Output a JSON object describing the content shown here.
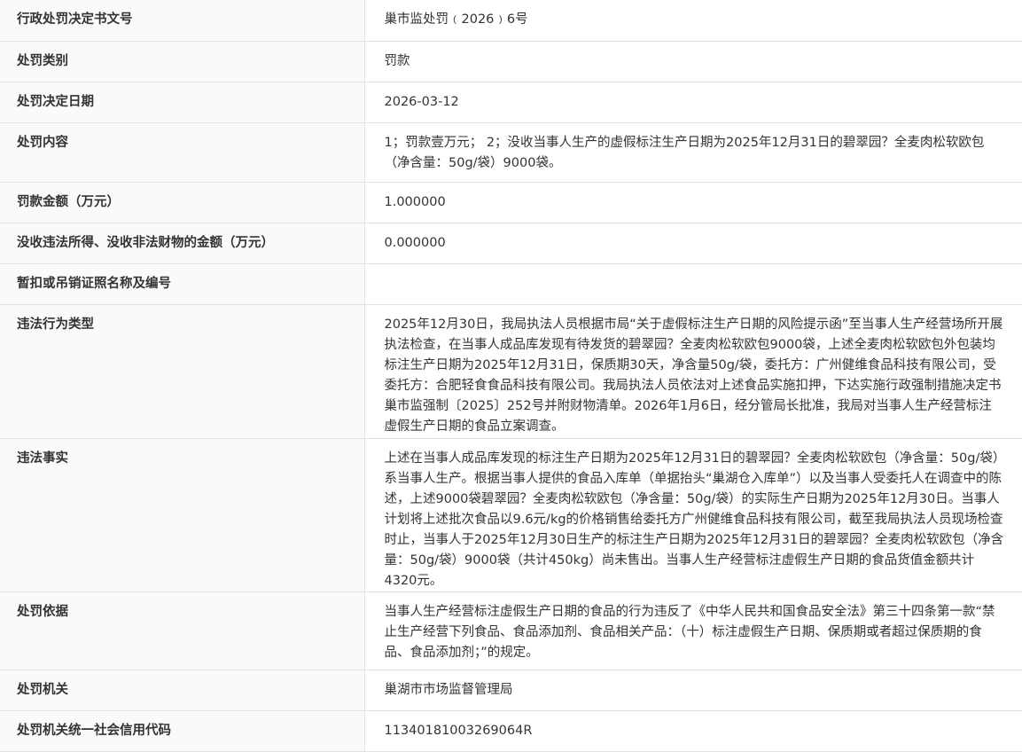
{
  "rows": [
    {
      "label": "行政处罚决定书文号",
      "value": "巢市监处罚﹙2026﹚6号"
    },
    {
      "label": "处罚类别",
      "value": "罚款"
    },
    {
      "label": "处罚决定日期",
      "value": "2026-03-12"
    },
    {
      "label": "处罚内容",
      "value": "1；罚款壹万元； 2；没收当事人生产的虚假标注生产日期为2025年12月31日的碧翠园？全麦肉松软欧包（净含量：50g/袋）9000袋。"
    },
    {
      "label": "罚款金额（万元）",
      "value": "1.000000"
    },
    {
      "label": "没收违法所得、没收非法财物的金额（万元）",
      "value": "0.000000"
    },
    {
      "label": "暂扣或吊销证照名称及编号",
      "value": ""
    },
    {
      "label": "违法行为类型",
      "value": "2025年12月30日，我局执法人员根据市局“关于虚假标注生产日期的风险提示函”至当事人生产经营场所开展执法检查，在当事人成品库发现有待发货的碧翠园？全麦肉松软欧包9000袋，上述全麦肉松软欧包外包装均标注生产日期为2025年12月31日，保质期30天，净含量50g/袋，委托方：广州健维食品科技有限公司，受委托方：合肥轻食食品科技有限公司。我局执法人员依法对上述食品实施扣押，下达实施行政强制措施决定书巢市监强制〔2025〕252号并附财物清单。2026年1月6日，经分管局长批准，我局对当事人生产经营标注虚假生产日期的食品立案调查。"
    },
    {
      "label": "违法事实",
      "value": "上述在当事人成品库发现的标注生产日期为2025年12月31日的碧翠园？全麦肉松软欧包（净含量：50g/袋）系当事人生产。根据当事人提供的食品入库单（单据抬头“巢湖仓入库单”）以及当事人受委托人在调查中的陈述，上述9000袋碧翠园？全麦肉松软欧包（净含量：50g/袋）的实际生产日期为2025年12月30日。当事人计划将上述批次食品以9.6元/kg的价格销售给委托方广州健维食品科技有限公司，截至我局执法人员现场检查时止，当事人于2025年12月30日生产的标注生产日期为2025年12月31日的碧翠园？全麦肉松软欧包（净含量：50g/袋）9000袋（共计450kg）尚未售出。当事人生产经营标注虚假生产日期的食品货值金额共计4320元。"
    },
    {
      "label": "处罚依据",
      "value": "当事人生产经营标注虚假生产日期的食品的行为违反了《中华人民共和国食品安全法》第三十四条第一款“禁止生产经营下列食品、食品添加剂、食品相关产品：（十）标注虚假生产日期、保质期或者超过保质期的食品、食品添加剂；”的规定。"
    },
    {
      "label": "处罚机关",
      "value": "巢湖市市场监督管理局"
    },
    {
      "label": "处罚机关统一社会信用代码",
      "value": "11340181003269064R"
    }
  ]
}
